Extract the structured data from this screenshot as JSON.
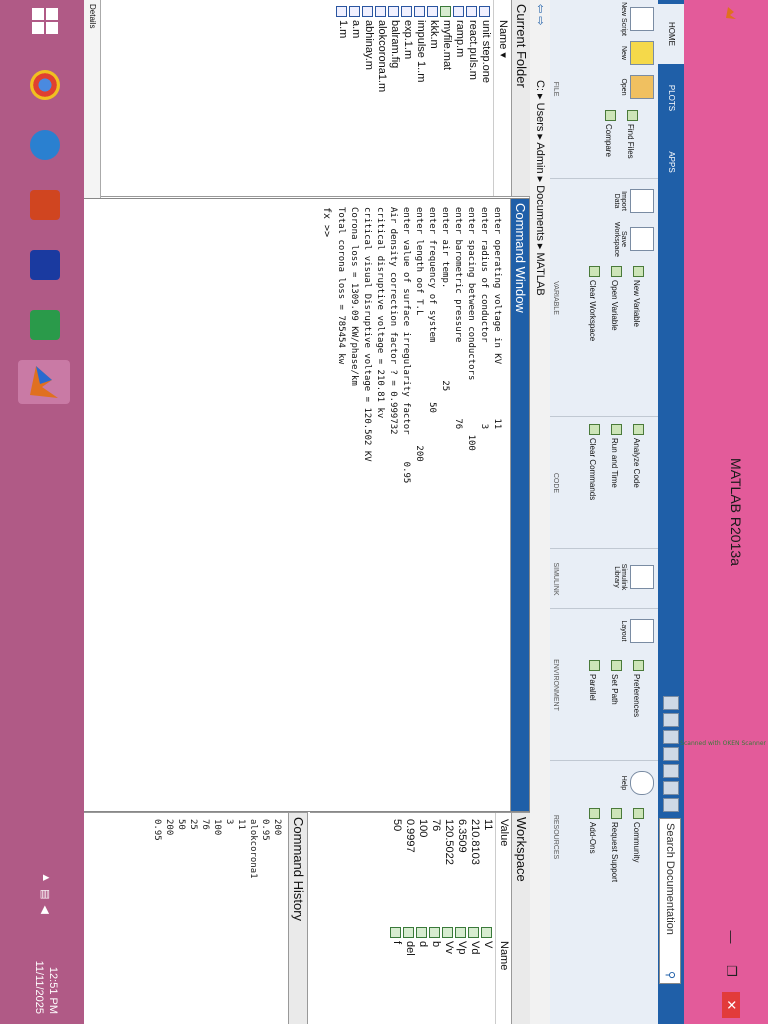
{
  "window": {
    "title": "MATLAB R2013a"
  },
  "tabs": [
    "HOME",
    "PLOTS",
    "APPS"
  ],
  "search": {
    "placeholder": "Search Documentation"
  },
  "ribbon": {
    "file": {
      "caption": "FILE",
      "new_script": "New Script",
      "new": "New",
      "open": "Open",
      "find_files": "Find Files",
      "compare": "Compare"
    },
    "variable": {
      "caption": "VARIABLE",
      "import": "Import Data",
      "save": "Save Workspace",
      "new_variable": "New Variable",
      "open_variable": "Open Variable",
      "clear_workspace": "Clear Workspace"
    },
    "code": {
      "caption": "CODE",
      "analyze": "Analyze Code",
      "run_time": "Run and Time",
      "clear_commands": "Clear Commands"
    },
    "simulink": {
      "caption": "SIMULINK",
      "library": "Simulink Library"
    },
    "environment": {
      "caption": "ENVIRONMENT",
      "layout": "Layout",
      "preferences": "Preferences",
      "set_path": "Set Path",
      "parallel": "Parallel"
    },
    "resources": {
      "caption": "RESOURCES",
      "help": "Help",
      "community": "Community",
      "request_support": "Request Support",
      "addons": "Add-Ons"
    }
  },
  "address": {
    "path": "C: ▸ Users ▸ Admin ▸ Documents ▸ MATLAB"
  },
  "current_folder": {
    "title": "Current Folder",
    "column": "Name",
    "files": [
      "unit step.one",
      "react.puls.m",
      "ramp.m",
      "myfile.mat",
      "kkk.m",
      "impulse 1..m",
      "exp.1.m",
      "balram.fig",
      "alokcorona1.m",
      "abhinay.m",
      "a.m",
      "1.m"
    ],
    "details": "Details"
  },
  "command_window": {
    "title": "Command Window",
    "lines": [
      "enter operating voltage in KV          11",
      "enter radius of conductor               3",
      "enter spacing between conductors          100",
      "enter barometric pressure              76",
      "enter air temp.                 25",
      "enter frequency of system           50",
      "enter length oof T.L                        200",
      "enter value of surface irregularity factor     0.95",
      "Air density correction factor ? = 0.999732",
      "critical disruptive voltage = 210.81 kv",
      "critical visual Disruptive voltage = 120.502 KV",
      "Corona loss = 1309.09 KW/phase/km",
      "Total corona loss = 785454 kw"
    ],
    "prompt": "fx >>"
  },
  "workspace": {
    "title": "Workspace",
    "col_name": "Name",
    "col_value": "Value",
    "rows": [
      {
        "name": "V",
        "value": "11"
      },
      {
        "name": "Vd",
        "value": "210.8103"
      },
      {
        "name": "Vp",
        "value": "6.3509"
      },
      {
        "name": "Vv",
        "value": "120.5022"
      },
      {
        "name": "b",
        "value": "76"
      },
      {
        "name": "d",
        "value": "100"
      },
      {
        "name": "del",
        "value": "0.9997"
      },
      {
        "name": "f",
        "value": "50"
      }
    ]
  },
  "command_history": {
    "title": "Command History",
    "items": [
      "200",
      "0.95",
      "alokcorona1",
      "11",
      "3",
      "100",
      "76",
      "25",
      "50",
      "200",
      "0.95"
    ]
  },
  "taskbar": {
    "time": "12:51 PM",
    "date": "11/11/2025"
  },
  "scanner_note": "Scanned with OKEN Scanner",
  "colors": {
    "title_bar": "#e35b9a",
    "ribbon_tab_bar": "#1f5fa8",
    "taskbar": "#b05a86"
  }
}
